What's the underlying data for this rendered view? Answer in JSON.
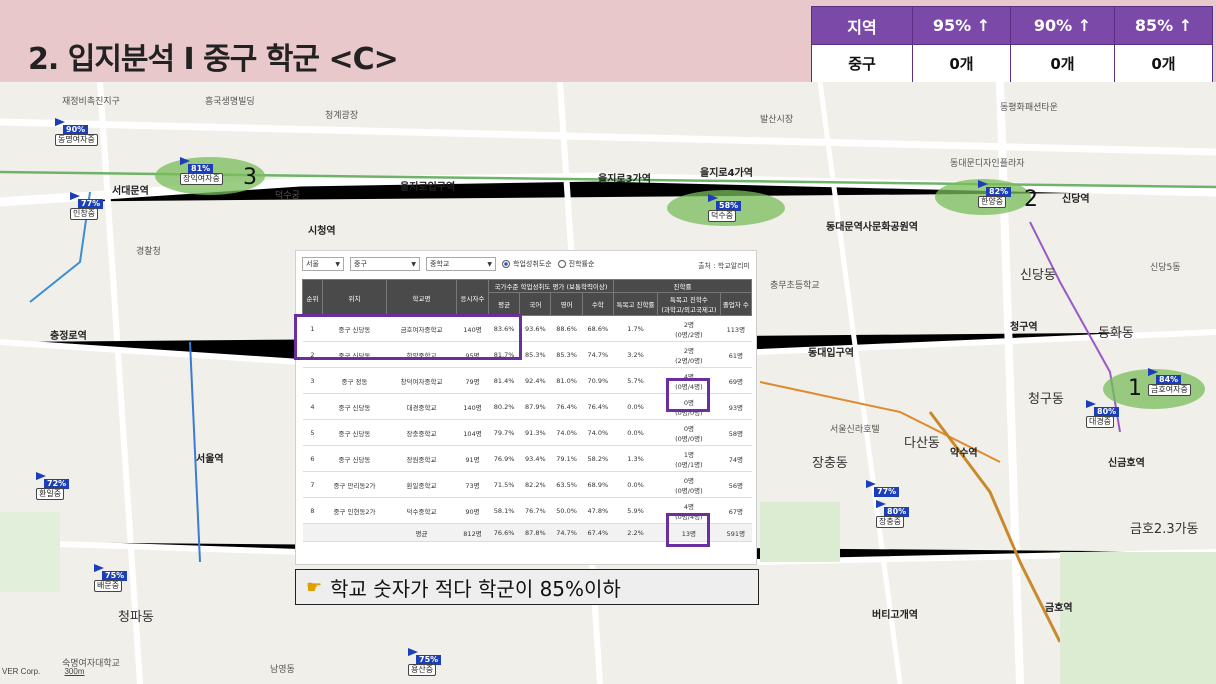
{
  "title": "2. 입지분석 I 중구 학군 <C>",
  "region_table": {
    "headers": [
      "지역",
      "95% ↑",
      "90% ↑",
      "85% ↑"
    ],
    "row": [
      "중구",
      "0개",
      "0개",
      "0개"
    ]
  },
  "map": {
    "labels": [
      "재정비촉진지구",
      "흥국생명빌딩",
      "청계광장",
      "발산시장",
      "동평화패션타운",
      "신당역",
      "서대문역",
      "동대문디자인플라자",
      "시청역",
      "을지로입구역",
      "을지로3가역",
      "을지로4가역",
      "동대문역사문화공원역",
      "덕수궁",
      "경찰청",
      "충정로역",
      "서울역",
      "동대입구역",
      "청구역",
      "청구동",
      "다산동",
      "약수역",
      "장충동",
      "신금호역",
      "금호역",
      "금호2.3가동",
      "버티고개역",
      "신당5동",
      "신당동",
      "동화동",
      "청파동",
      "남영동",
      "숙명여자대학교",
      "서울신라호텔",
      "충무초등학교",
      "동대문역사공원역"
    ],
    "schools": [
      {
        "num": "1",
        "pct": "84%",
        "name": "금호여자중"
      },
      {
        "num": "2",
        "pct": "82%",
        "name": "한양중"
      },
      {
        "num": "3",
        "pct": "81%",
        "name": "장익여자중"
      }
    ],
    "markers": [
      {
        "pct": "90%",
        "name": "동명여자중"
      },
      {
        "pct": "77%",
        "name": "인창중"
      },
      {
        "pct": "58%",
        "name": "덕수중"
      },
      {
        "pct": "80%",
        "name": "대경중"
      },
      {
        "pct": "72%",
        "name": "환일중"
      },
      {
        "pct": "75%",
        "name": "배문중"
      },
      {
        "pct": "77%",
        "name": "장충중"
      },
      {
        "pct": "80%",
        "name": "장충중"
      },
      {
        "pct": "75%",
        "name": "용산중"
      }
    ],
    "naver": "VER Corp.",
    "scale": "300m"
  },
  "panel": {
    "filters": [
      "서울",
      "중구",
      "중학교"
    ],
    "radios": [
      "학업성취도순",
      "진학률순"
    ],
    "source": "출처 : 학교알리미",
    "group_headers": {
      "national": "국가수준 학업성취도 평가 (보통학력이상)",
      "progress": "진학률"
    },
    "col_headers": [
      "순위",
      "위치",
      "학교명",
      "응시자수",
      "평균",
      "국어",
      "영어",
      "수학",
      "특목고 진학률",
      "특목고 진학수",
      "졸업자 수"
    ],
    "progress_sub": "(과학고/외고국제고)",
    "rows": [
      [
        "1",
        "중구 신당동",
        "금호여자중학교",
        "140명",
        "83.6%",
        "93.6%",
        "88.6%",
        "68.6%",
        "1.7%",
        "2명",
        "(0명/2명)",
        "113명"
      ],
      [
        "2",
        "중구 신당동",
        "한양중학교",
        "95명",
        "81.7%",
        "85.3%",
        "85.3%",
        "74.7%",
        "3.2%",
        "2명",
        "(2명/0명)",
        "61명"
      ],
      [
        "3",
        "중구 정동",
        "창덕여자중학교",
        "79명",
        "81.4%",
        "92.4%",
        "81.0%",
        "70.9%",
        "5.7%",
        "4명",
        "(0명/4명)",
        "69명"
      ],
      [
        "4",
        "중구 신당동",
        "대경중학교",
        "140명",
        "80.2%",
        "87.9%",
        "76.4%",
        "76.4%",
        "0.0%",
        "0명",
        "(0명/0명)",
        "93명"
      ],
      [
        "5",
        "중구 신당동",
        "장충중학교",
        "104명",
        "79.7%",
        "91.3%",
        "74.0%",
        "74.0%",
        "0.0%",
        "0명",
        "(0명/0명)",
        "58명"
      ],
      [
        "6",
        "중구 신당동",
        "장원중학교",
        "91명",
        "76.9%",
        "93.4%",
        "79.1%",
        "58.2%",
        "1.3%",
        "1명",
        "(0명/1명)",
        "74명"
      ],
      [
        "7",
        "중구 만리동2가",
        "환일중학교",
        "73명",
        "71.5%",
        "82.2%",
        "63.5%",
        "68.9%",
        "0.0%",
        "0명",
        "(0명/0명)",
        "56명"
      ],
      [
        "8",
        "중구 인현동2가",
        "덕수중학교",
        "90명",
        "58.1%",
        "76.7%",
        "50.0%",
        "47.8%",
        "5.9%",
        "4명",
        "(0명/4명)",
        "67명"
      ]
    ],
    "avg": [
      "",
      "",
      "평균",
      "812명",
      "76.6%",
      "87.8%",
      "74.7%",
      "67.4%",
      "2.2%",
      "13명",
      "591명"
    ]
  },
  "callout": "학교 숫자가 적다 학군이 85%이하",
  "colors": {
    "header_bg": "#e8c8cb",
    "purple": "#7b4aa8",
    "highlight": "#6a2e9e",
    "marker": "#1c3fb8"
  }
}
